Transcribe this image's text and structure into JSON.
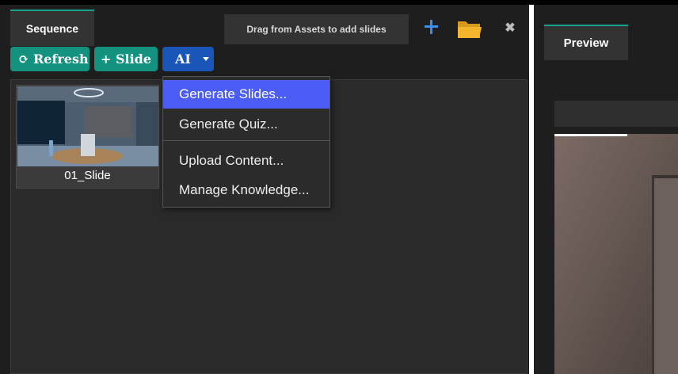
{
  "tabs": {
    "sequence": "Sequence",
    "preview": "Preview"
  },
  "toolbar": {
    "drag_hint": "Drag from Assets to add slides",
    "refresh_label": "⟳ Refresh",
    "add_slide_label": "+ Slide",
    "ai_label": "AI"
  },
  "icons": {
    "add": "plus-icon",
    "open": "folder-icon",
    "close": "close-icon"
  },
  "colors": {
    "accent_teal": "#13937f",
    "ai_blue": "#1a55b8",
    "menu_highlight": "#4c5cf7",
    "plus_blue": "#3b8eea",
    "folder_yellow": "#f3b52e"
  },
  "slides": [
    {
      "label": "01_Slide"
    }
  ],
  "ai_menu": {
    "items": [
      {
        "label": "Generate Slides...",
        "highlighted": true
      },
      {
        "label": "Generate Quiz..."
      },
      {
        "label": "Upload Content..."
      },
      {
        "label": "Manage Knowledge..."
      }
    ]
  }
}
